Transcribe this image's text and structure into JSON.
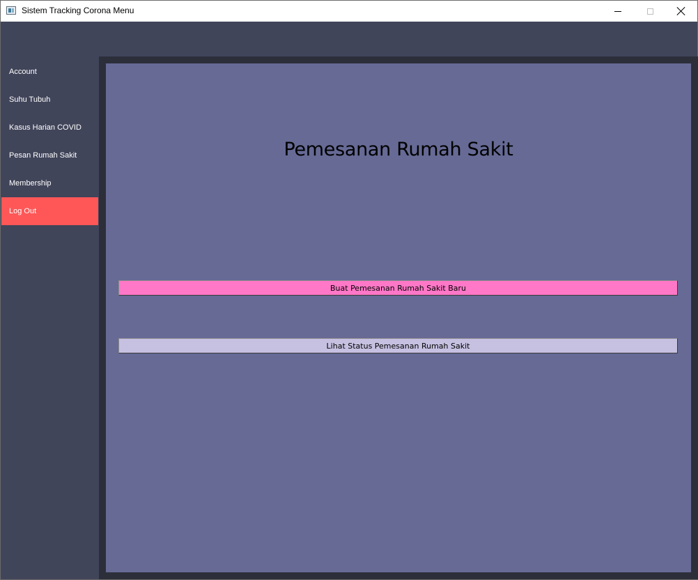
{
  "window": {
    "title": "Sistem Tracking Corona Menu"
  },
  "sidebar": {
    "items": [
      {
        "label": "Account"
      },
      {
        "label": "Suhu Tubuh"
      },
      {
        "label": "Kasus Harian COVID"
      },
      {
        "label": "Pesan Rumah Sakit"
      },
      {
        "label": "Membership"
      },
      {
        "label": "Log Out"
      }
    ]
  },
  "main": {
    "title": "Pemesanan Rumah Sakit",
    "buttons": {
      "new_booking": "Buat Pemesanan Rumah Sakit Baru",
      "view_status": "Lihat Status Pemesanan Rumah Sakit"
    }
  },
  "colors": {
    "sidebar_bg": "#41455a",
    "content_bg": "#666a95",
    "logout_bg": "#ff5757",
    "new_booking_btn": "#ff77c7",
    "view_status_btn": "#c6c0e1"
  },
  "icons": {
    "app": "app-window-icon",
    "minimize": "minimize-icon",
    "maximize": "maximize-icon",
    "close": "close-icon"
  }
}
